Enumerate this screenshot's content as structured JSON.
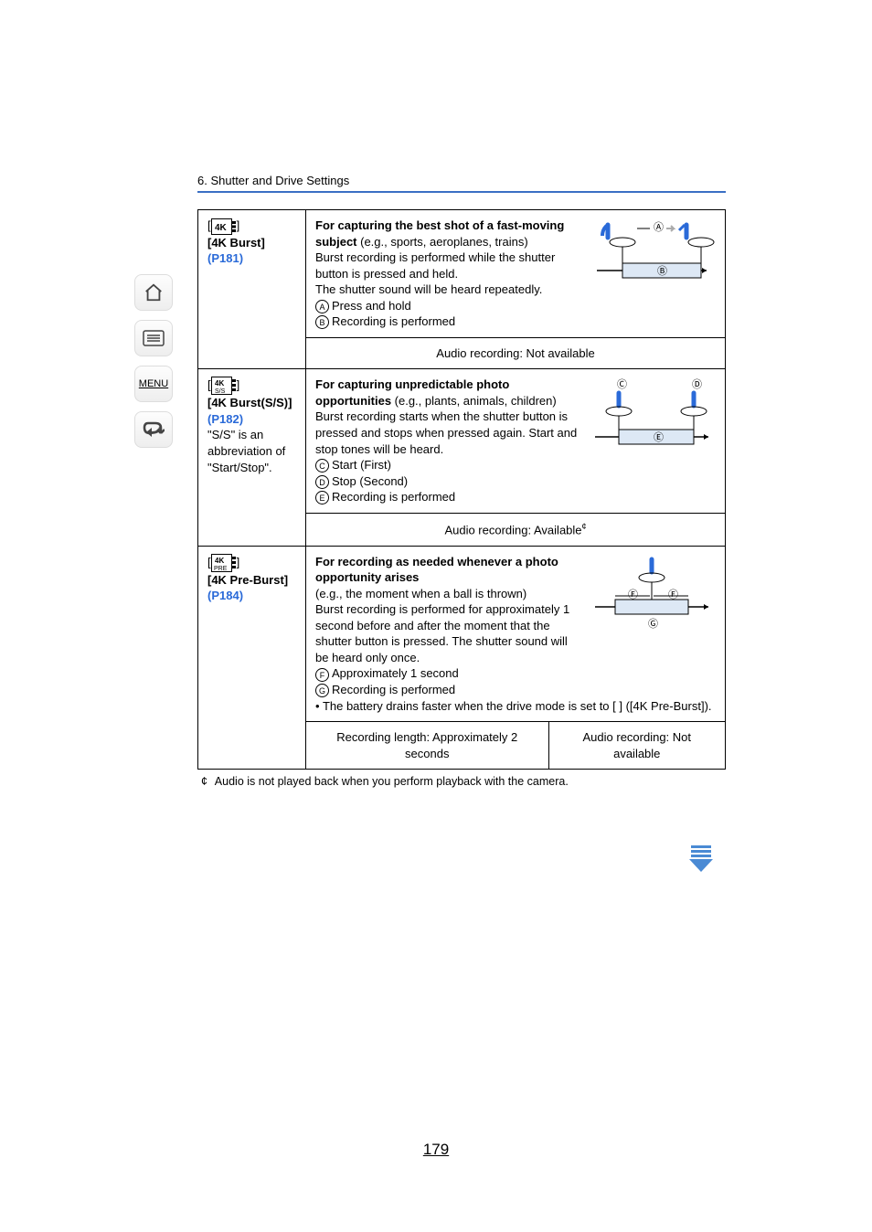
{
  "breadcrumb": "6. Shutter and Drive Settings",
  "page_number": "179",
  "footnote_marker": "¢",
  "footnote_text": "Audio is not played back when you perform playback with the camera.",
  "sidebar": {
    "home": "home-icon",
    "toc": "contents-icon",
    "menu_label": "MENU",
    "back": "back-icon"
  },
  "rows": [
    {
      "mode": {
        "icon_label": "4k-burst-icon",
        "bracket_open": "[",
        "bracket_close": "]",
        "name": "[4K Burst]",
        "page_ref": "(P181)",
        "extra_note": ""
      },
      "desc": {
        "bold1": "For capturing the best shot of a fast-moving subject",
        "plain1": " (e.g., sports, aeroplanes, trains)",
        "line2a": "Burst recording is performed while the shutter button is pressed and held.",
        "line2b": "The shutter sound will be heard repeatedly.",
        "items": [
          {
            "marker": "A",
            "text": "Press and hold"
          },
          {
            "marker": "B",
            "text": "Recording is performed"
          }
        ],
        "bullet": ""
      },
      "diagram": {
        "labels": [
          "A",
          "B"
        ]
      },
      "audio": {
        "type": "single",
        "text": "Audio recording: Not available"
      }
    },
    {
      "mode": {
        "icon_label": "4k-burst-ss-icon",
        "bracket_open": "[",
        "bracket_close": "]",
        "name": "[4K Burst(S/S)]",
        "page_ref": "(P182)",
        "extra_note": "\"S/S\" is an abbreviation of \"Start/Stop\"."
      },
      "desc": {
        "bold1": "For capturing unpredictable photo opportunities",
        "plain1": " (e.g., plants, animals, children)",
        "line2a": "Burst recording starts when the shutter button is pressed and stops when pressed again. Start and stop tones will be heard.",
        "line2b": "",
        "items": [
          {
            "marker": "C",
            "text": "Start (First)"
          },
          {
            "marker": "D",
            "text": "Stop (Second)"
          },
          {
            "marker": "E",
            "text": "Recording is performed"
          }
        ],
        "bullet": ""
      },
      "diagram": {
        "labels": [
          "C",
          "D",
          "E"
        ]
      },
      "audio": {
        "type": "single_sup",
        "text": "Audio recording: Available",
        "sup": "¢"
      }
    },
    {
      "mode": {
        "icon_label": "4k-pre-burst-icon",
        "bracket_open": "[",
        "bracket_close": "]",
        "name": "[4K Pre-Burst]",
        "page_ref": "(P184)",
        "extra_note": ""
      },
      "desc": {
        "bold1": "For recording as needed whenever a photo opportunity arises",
        "plain1": "",
        "line2a": "(e.g., the moment when a ball is thrown)",
        "line2b": "Burst recording is performed for approximately 1 second before and after the moment that the shutter button is pressed. The shutter sound will be heard only once.",
        "items": [
          {
            "marker": "F",
            "text": "Approximately 1 second"
          },
          {
            "marker": "G",
            "text": "Recording is performed"
          }
        ],
        "bullet": "The battery drains faster when the drive mode is set to [      ] ([4K Pre-Burst])."
      },
      "diagram": {
        "labels": [
          "F",
          "F",
          "G"
        ]
      },
      "audio": {
        "type": "double",
        "left": "Recording length: Approximately 2 seconds",
        "right": "Audio recording: Not available"
      }
    }
  ]
}
